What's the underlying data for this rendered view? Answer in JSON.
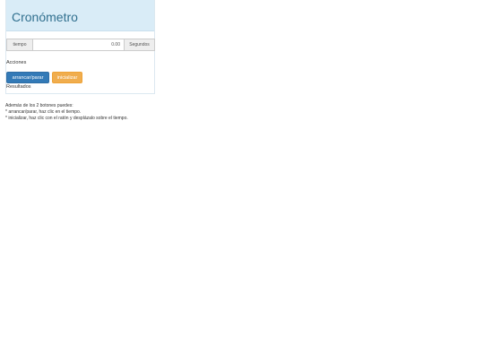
{
  "header": {
    "title": "Cronómetro"
  },
  "timer": {
    "left_label": "tiempo",
    "value": "0.00",
    "unit": "Segundos"
  },
  "actions": {
    "label": "Acciones",
    "start_stop": "arrancar/parar",
    "reset": "inicializar"
  },
  "results": {
    "label": "Resultados"
  },
  "help": {
    "intro": "Además de los 2 botones puedes:",
    "line1": "* arrancar/parar, haz clic en el tiempo.",
    "line2": "* inicializar, haz clic con el ratón y desplázalo sobre el tiempo."
  },
  "colors": {
    "header_bg": "#d9ecf7",
    "title": "#31708f",
    "primary_button": "#337ab7",
    "warning_button": "#f0ad4e"
  }
}
